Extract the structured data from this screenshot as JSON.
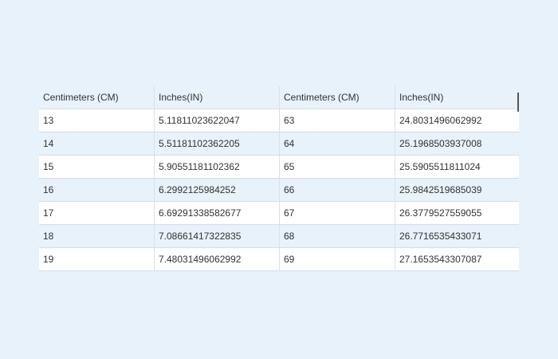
{
  "table": {
    "headers": [
      "Centimeters (CM)",
      "Inches(IN)",
      "Centimeters (CM)",
      "Inches(IN)"
    ],
    "rows": [
      [
        "13",
        "5.11811023622047",
        "63",
        "24.8031496062992"
      ],
      [
        "14",
        "5.51181102362205",
        "64",
        "25.1968503937008"
      ],
      [
        "15",
        "5.90551181102362",
        "65",
        "25.5905511811024"
      ],
      [
        "16",
        "6.2992125984252",
        "66",
        "25.9842519685039"
      ],
      [
        "17",
        "6.69291338582677",
        "67",
        "26.3779527559055"
      ],
      [
        "18",
        "7.08661417322835",
        "68",
        "26.7716535433071"
      ],
      [
        "19",
        "7.48031496062992",
        "69",
        "27.1653543307087"
      ]
    ]
  }
}
